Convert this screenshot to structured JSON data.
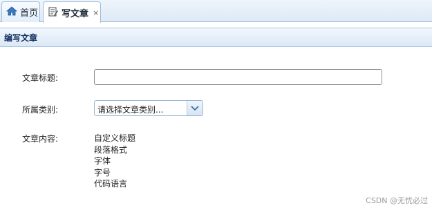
{
  "tabs": {
    "home_label": "首页",
    "write_label": "写文章",
    "close_glyph": "×"
  },
  "panel": {
    "title": "编写文章"
  },
  "form": {
    "title_label": "文章标题:",
    "title_value": "",
    "category_label": "所属类别:",
    "category_value": "请选择文章类别...",
    "content_label": "文章内容:",
    "toolbar_items": [
      "自定义标题",
      "段落格式",
      "字体",
      "字号",
      "代码语言"
    ]
  },
  "watermark": "CSDN @无忧必过",
  "colors": {
    "tab_border": "#9fbbd9",
    "panel_header": "#dbe8f6",
    "panel_title": "#0e2d5f"
  },
  "icons": {
    "home": "home-icon",
    "edit": "edit-document-icon",
    "dropdown": "chevron-down-icon"
  }
}
